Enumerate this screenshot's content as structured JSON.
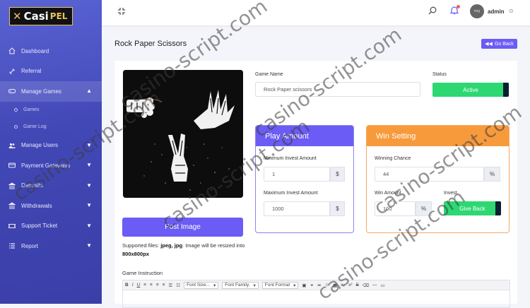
{
  "logo": {
    "main": "Casi",
    "accent": "PEL"
  },
  "sidebar": {
    "items": [
      {
        "label": "Dashboard",
        "icon": "home-icon",
        "chevron": ""
      },
      {
        "label": "Referral",
        "icon": "link-icon",
        "chevron": ""
      },
      {
        "label": "Manage Games",
        "icon": "gamepad-icon",
        "chevron": "▲"
      },
      {
        "label": "Manage Users",
        "icon": "users-icon",
        "chevron": "▼"
      },
      {
        "label": "Payment Gateways",
        "icon": "credit-card-icon",
        "chevron": "▼"
      },
      {
        "label": "Deposits",
        "icon": "bank-icon",
        "chevron": "▼"
      },
      {
        "label": "Withdrawals",
        "icon": "bank-icon",
        "chevron": "▼"
      },
      {
        "label": "Support Ticket",
        "icon": "ticket-icon",
        "chevron": "▼"
      },
      {
        "label": "Report",
        "icon": "list-icon",
        "chevron": "▼"
      }
    ],
    "sub_items": [
      {
        "label": "Games"
      },
      {
        "label": "Game Log"
      }
    ]
  },
  "topbar": {
    "user": "admin",
    "avatar_text": "img"
  },
  "page": {
    "title": "Rock Paper Scissors",
    "go_back": "Go Back"
  },
  "form": {
    "post_image": "Post Image",
    "supported_prefix": "Supported files: ",
    "supported_types": "jpeg, jpg",
    "supported_mid": ". Image will be resized into ",
    "supported_size": "800x800px",
    "game_name_label": "Game Name",
    "game_name_value": "Rock Paper scissors",
    "status_label": "Status",
    "status_value": "Active",
    "play_amount_title": "Play Amount",
    "min_invest_label": "Minimum Invest Amount",
    "min_invest_value": "1",
    "max_invest_label": "Maximum Invest Amount",
    "max_invest_value": "1000",
    "currency_symbol": "$",
    "win_setting_title": "Win Setting",
    "winning_chance_label": "Winning Chance",
    "winning_chance_value": "44",
    "win_amount_label": "Win Amount",
    "win_amount_value": "100",
    "percent_symbol": "%",
    "invest_label": "Invest",
    "invest_value": "Give Back",
    "instruction_label": "Game Instruction"
  },
  "editor": {
    "font_size": "Font Size...",
    "font_family": "Font Family.",
    "font_format": "Font Format"
  },
  "watermark": "casino-script.com",
  "colors": {
    "accent": "#6b5cf5",
    "success": "#2dd872",
    "orange": "#f79a3c",
    "sidebar": "#4147b5"
  }
}
